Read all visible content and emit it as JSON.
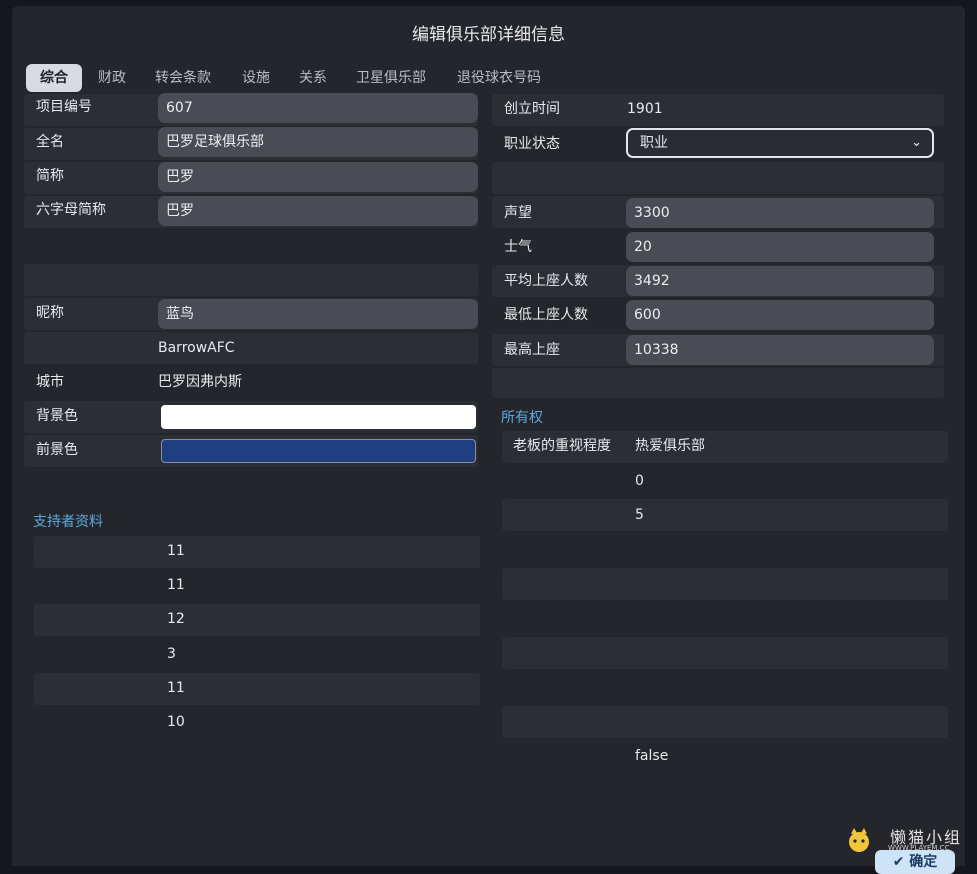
{
  "window": {
    "title": "编辑俱乐部详细信息"
  },
  "tabs": [
    "综合",
    "财政",
    "转会条款",
    "设施",
    "关系",
    "卫星俱乐部",
    "退役球衣号码"
  ],
  "left": {
    "project_id": {
      "label": "项目编号",
      "value": "607"
    },
    "full_name": {
      "label": "全名",
      "value": "巴罗足球俱乐部"
    },
    "short_name": {
      "label": "简称",
      "value": "巴罗"
    },
    "six_letter": {
      "label": "六字母简称",
      "value": "巴罗"
    },
    "nickname": {
      "label": "昵称",
      "value": "蓝鸟"
    },
    "nickname_extra": "BarrowAFC",
    "city": {
      "label": "城市",
      "value": "巴罗因弗内斯"
    },
    "bg_color": {
      "label": "背景色",
      "color": "#ffffff"
    },
    "fg_color": {
      "label": "前景色",
      "color": "#203f82"
    },
    "supporters": {
      "heading": "支持者资料",
      "values": [
        "11",
        "11",
        "12",
        "3",
        "11",
        "10"
      ]
    }
  },
  "right": {
    "founded": {
      "label": "创立时间",
      "value": "1901"
    },
    "status": {
      "label": "职业状态",
      "value": "职业"
    },
    "reputation": {
      "label": "声望",
      "value": "3300"
    },
    "morale": {
      "label": "士气",
      "value": "20"
    },
    "avg_attendance": {
      "label": "平均上座人数",
      "value": "3492"
    },
    "min_attendance": {
      "label": "最低上座人数",
      "value": "600"
    },
    "max_attendance": {
      "label": "最高上座",
      "value": "10338"
    },
    "ownership": {
      "heading": "所有权",
      "boss_focus": {
        "label": "老板的重视程度",
        "value": "热爱俱乐部"
      },
      "val1": "0",
      "val2": "5",
      "bool": "false"
    }
  },
  "buttons": {
    "ok": "✔ 确定"
  },
  "watermark": {
    "name": "懒猫小组",
    "site": "WWW.PLAYEM.CC"
  },
  "colors": {
    "accent": "#5aa9de",
    "panel": "#24262c",
    "field": "#4a4c55"
  }
}
